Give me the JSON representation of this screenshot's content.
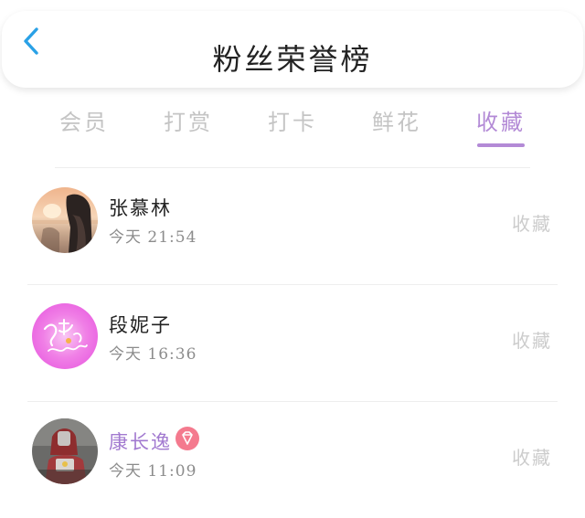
{
  "header": {
    "title": "粉丝荣誉榜",
    "back_icon": "chevron-left-icon",
    "back_color": "#2aa1e6"
  },
  "tabs": [
    {
      "label": "会员",
      "active": false
    },
    {
      "label": "打赏",
      "active": false
    },
    {
      "label": "打卡",
      "active": false
    },
    {
      "label": "鲜花",
      "active": false
    },
    {
      "label": "收藏",
      "active": true
    }
  ],
  "colors": {
    "accent": "#b38ad6",
    "inactive_tab": "#c4c4c4",
    "badge": "#f47a8e"
  },
  "fans": [
    {
      "name": "张慕林",
      "time": "今天 21:54",
      "action": "收藏",
      "vip": false,
      "avatar": "avatar-photo-sunset"
    },
    {
      "name": "段妮子",
      "time": "今天 16:36",
      "action": "收藏",
      "vip": false,
      "avatar": "avatar-pink-script"
    },
    {
      "name": "康长逸",
      "time": "今天 11:09",
      "action": "收藏",
      "vip": true,
      "badge_icon": "diamond-icon",
      "avatar": "avatar-photo-figure"
    }
  ]
}
